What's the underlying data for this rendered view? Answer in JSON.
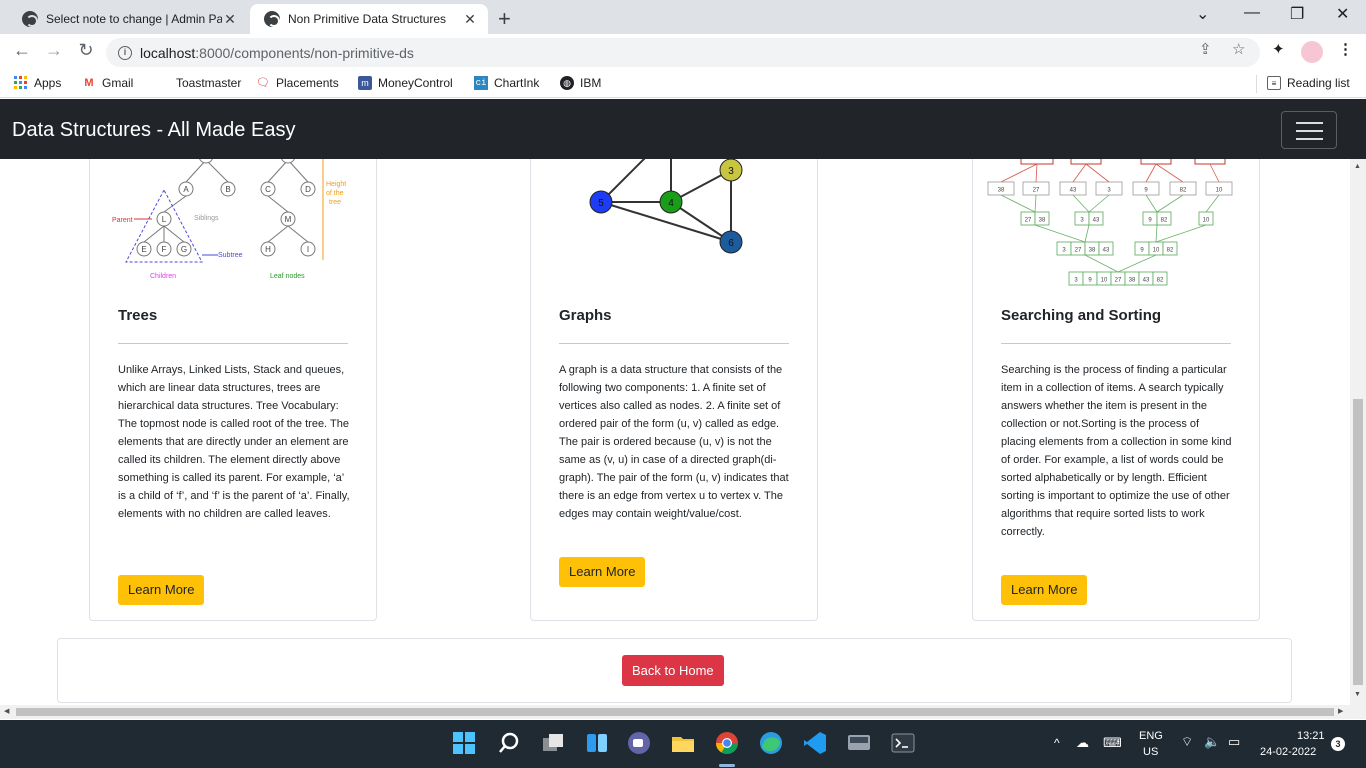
{
  "browser": {
    "tabs": [
      {
        "title": "Select note to change | Admin Pa",
        "active": false
      },
      {
        "title": "Non Primitive Data Structures",
        "active": true
      }
    ],
    "url_host": "localhost",
    "url_path": ":8000/components/non-primitive-ds",
    "bookmarks": [
      {
        "label": "Apps",
        "icon": "apps-grid-icon"
      },
      {
        "label": "Gmail",
        "icon": "gmail-icon"
      },
      {
        "label": "Toastmaster",
        "icon": "none"
      },
      {
        "label": "Placements",
        "icon": "speech-bubble-icon"
      },
      {
        "label": "MoneyControl",
        "icon": "moneycontrol-icon"
      },
      {
        "label": "ChartInk",
        "icon": "chartink-icon"
      },
      {
        "label": "IBM",
        "icon": "globe-icon"
      }
    ],
    "reading_list": "Reading list"
  },
  "navbar": {
    "brand": "Data Structures - All Made Easy"
  },
  "cards": [
    {
      "title": "Trees",
      "description": "Unlike Arrays, Linked Lists, Stack and queues, which are linear data structures, trees are hierarchical data structures. Tree Vocabulary: The topmost node is called root of the tree. The elements that are directly under an element are called its children. The element directly above something is called its parent. For example, ‘a’ is a child of ‘f’, and ‘f’ is the parent of ‘a’. Finally, elements with no children are called leaves.",
      "button": "Learn More",
      "illustration_labels": {
        "nodes": [
          "A",
          "B",
          "C",
          "D",
          "L",
          "M",
          "E",
          "F",
          "G",
          "H",
          "I"
        ],
        "parent": "Parent",
        "siblings": "Siblings",
        "subtree": "Subtree",
        "children": "Children",
        "leaf_nodes": "Leaf nodes",
        "height": [
          "Height",
          "of the",
          "tree"
        ]
      }
    },
    {
      "title": "Graphs",
      "description": "A graph is a data structure that consists of the following two components: 1. A finite set of vertices also called as nodes. 2. A finite set of ordered pair of the form (u, v) called as edge. The pair is ordered because (u, v) is not the same as (v, u) in case of a directed graph(di-graph). The pair of the form (u, v) indicates that there is an edge from vertex u to vertex v. The edges may contain weight/value/cost.",
      "button": "Learn More",
      "illustration_labels": {
        "nodes": [
          "5",
          "4",
          "3",
          "6"
        ]
      }
    },
    {
      "title": "Searching and Sorting",
      "description": "Searching is the process of finding a particular item in a collection of items. A search typically answers whether the item is present in the collection or not.Sorting is the process of placing elements from a collection in some kind of order. For example, a list of words could be sorted alphabetically or by length. Efficient sorting is important to optimize the use of other algorithms that require sorted lists to work correctly.",
      "button": "Learn More",
      "illustration_labels": {
        "row1": [
          "38",
          "27",
          "43",
          "3",
          "9",
          "82",
          "10"
        ],
        "row2": [
          "27 38",
          "3 43",
          "9 82",
          "10"
        ],
        "row3": [
          "3 27 38 43",
          "9 10 82"
        ],
        "row4": [
          "3 9 10 27 38 43 82"
        ]
      }
    }
  ],
  "footer": {
    "back_button": "Back to Home"
  },
  "taskbar": {
    "lang_top": "ENG",
    "lang_bottom": "US",
    "time": "13:21",
    "date": "24-02-2022",
    "notification_count": "3"
  }
}
